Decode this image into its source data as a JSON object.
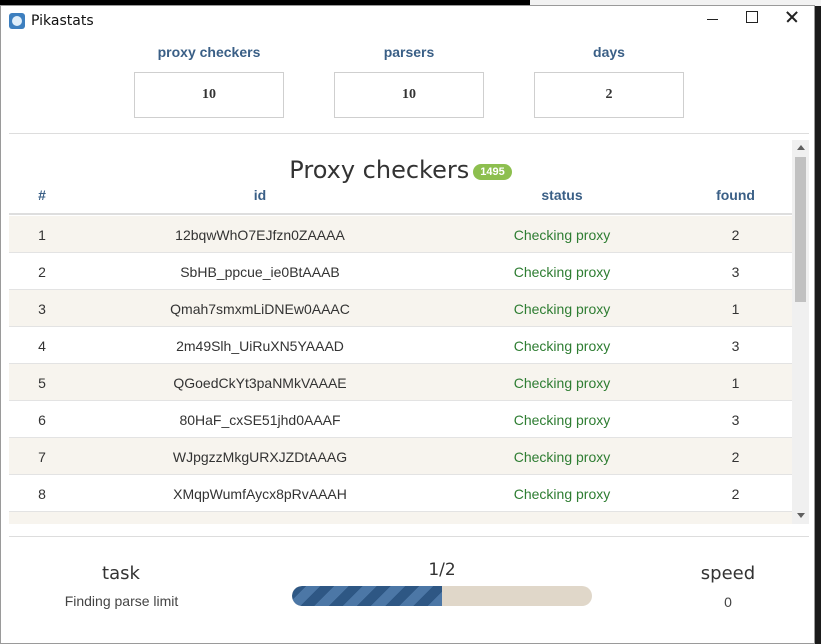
{
  "window": {
    "title": "Pikastats"
  },
  "config": {
    "proxy_checkers": {
      "label": "proxy checkers",
      "value": "10"
    },
    "parsers": {
      "label": "parsers",
      "value": "10"
    },
    "days": {
      "label": "days",
      "value": "2"
    }
  },
  "table": {
    "title": "Proxy checkers",
    "badge": "1495",
    "headers": {
      "num": "#",
      "id": "id",
      "status": "status",
      "found": "found"
    },
    "rows": [
      {
        "num": "1",
        "id": "12bqwWhO7EJfzn0ZAAAA",
        "status": "Checking proxy",
        "found": "2"
      },
      {
        "num": "2",
        "id": "SbHB_ppcue_ie0BtAAAB",
        "status": "Checking proxy",
        "found": "3"
      },
      {
        "num": "3",
        "id": "Qmah7smxmLiDNEw0AAAC",
        "status": "Checking proxy",
        "found": "1"
      },
      {
        "num": "4",
        "id": "2m49Slh_UiRuXN5YAAAD",
        "status": "Checking proxy",
        "found": "3"
      },
      {
        "num": "5",
        "id": "QGoedCkYt3paNMkVAAAE",
        "status": "Checking proxy",
        "found": "1"
      },
      {
        "num": "6",
        "id": "80HaF_cxSE51jhd0AAAF",
        "status": "Checking proxy",
        "found": "3"
      },
      {
        "num": "7",
        "id": "WJpgzzMkgURXJZDtAAAG",
        "status": "Checking proxy",
        "found": "2"
      },
      {
        "num": "8",
        "id": "XMqpWumfAycx8pRvAAAH",
        "status": "Checking proxy",
        "found": "2"
      }
    ]
  },
  "status": {
    "task_label": "task",
    "task_value": "Finding parse limit",
    "progress_text": "1/2",
    "progress_fraction": 0.5,
    "speed_label": "speed",
    "speed_value": "0"
  },
  "colors": {
    "header_blue": "#3a5f86",
    "status_green": "#2e7d32",
    "badge_green": "#8dbf4f",
    "row_alt": "#f7f4ee",
    "progress_fill": "#2e5784",
    "progress_track": "#e0d7c9"
  },
  "icons": {
    "app": "pikachu-app-icon",
    "minimize": "minimize-icon",
    "maximize": "maximize-icon",
    "close": "close-icon"
  }
}
